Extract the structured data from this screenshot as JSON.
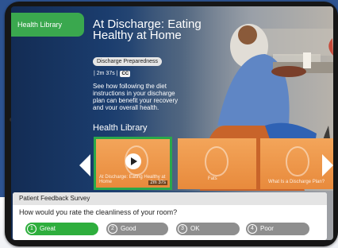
{
  "nav": {
    "tab_label": "Health Library"
  },
  "video": {
    "title": "At Discharge: Eating Healthy at Home",
    "badge": "Discharge Preparedness",
    "meta": "| 2m 37s |",
    "cc_label": "CC",
    "description": "See how following the diet instructions in your discharge plan can benefit your recovery and your overall health."
  },
  "library": {
    "heading": "Health Library",
    "thumbs": [
      {
        "caption": "At Discharge: Eating Healthy at Home",
        "duration": "2m 37s",
        "selected": true
      },
      {
        "caption": "Fats"
      },
      {
        "caption": "What Is a Discharge Plan?"
      }
    ]
  },
  "survey": {
    "title": "Patient Feedback Survey",
    "question": "How would you rate the cleanliness of your room?",
    "options": [
      {
        "num": "1",
        "label": "Great",
        "selected": true
      },
      {
        "num": "2",
        "label": "Good"
      },
      {
        "num": "3",
        "label": "OK"
      },
      {
        "num": "4",
        "label": "Poor"
      }
    ]
  },
  "colors": {
    "accent": "#3aa84e",
    "selected_option": "#2eae3d",
    "option": "#8e8e8e",
    "background_band": "#2d5391"
  }
}
